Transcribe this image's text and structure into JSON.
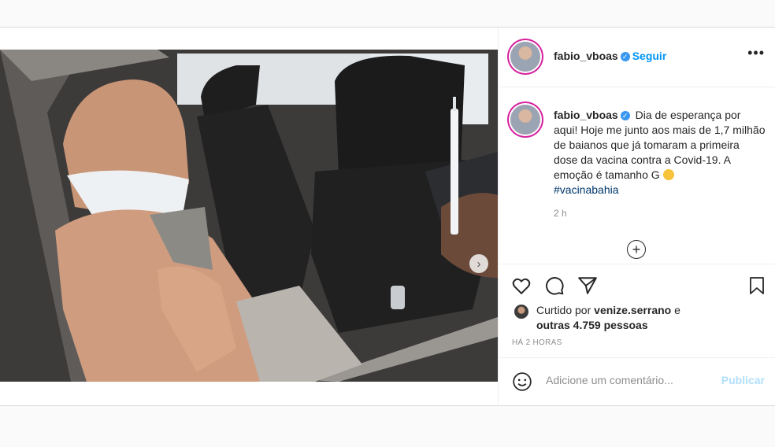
{
  "post": {
    "username": "fabio_vboas",
    "follow_label": "Seguir",
    "caption": "Dia de esperança por aqui! Hoje me junto aos mais de 1,7 milhão de baianos que já tomaram a primeira dose da vacina contra a Covid-19. A emoção é tamanho G",
    "hashtag": "#vacinabahia",
    "caption_time": "2 h",
    "liked_by_prefix": "Curtido por",
    "liked_by_user": "venize.serrano",
    "liked_by_and": "e",
    "others_label": "outras 4.759 pessoas",
    "posted_ago": "HÁ 2 HORAS",
    "comment_placeholder": "Adicione um comentário...",
    "publish_label": "Publicar",
    "carousel": {
      "total": 3,
      "active": 0
    }
  },
  "icons": {
    "more": "more-options-icon",
    "like": "heart-icon",
    "comment": "comment-icon",
    "share": "send-icon",
    "save": "bookmark-icon",
    "emoji": "emoji-icon",
    "add": "plus-circle-icon",
    "next": "chevron-right-icon"
  },
  "colors": {
    "link": "#0095f6",
    "hashtag": "#00376b",
    "muted": "#8e8e8e",
    "publish_disabled": "#b2dffc"
  }
}
